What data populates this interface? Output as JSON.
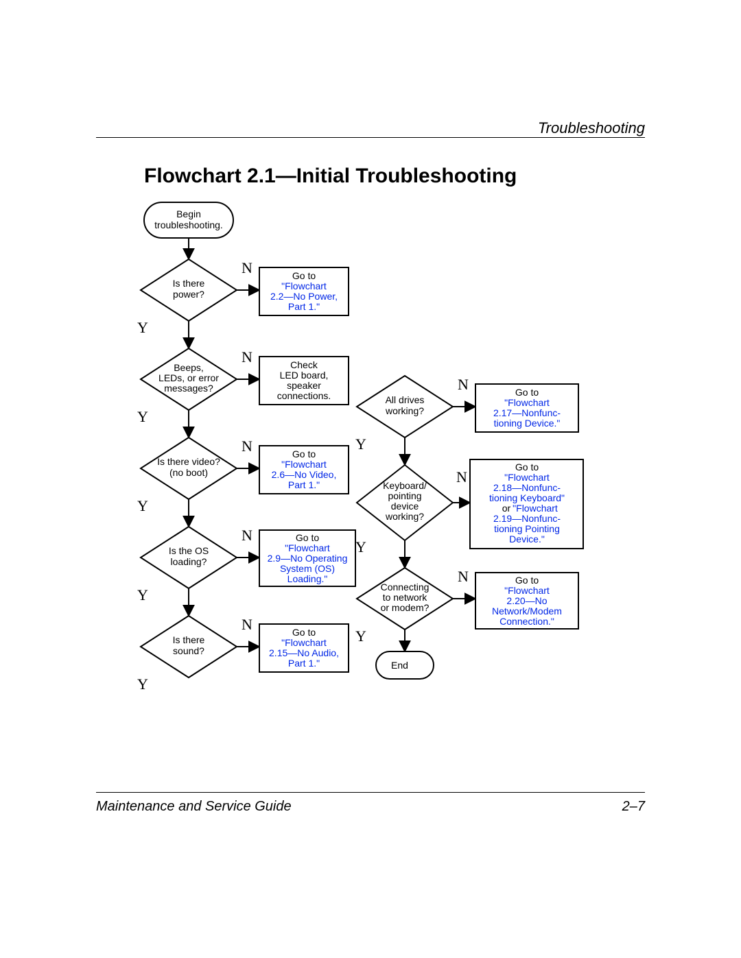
{
  "header": {
    "section": "Troubleshooting"
  },
  "title": "Flowchart 2.1—Initial Troubleshooting",
  "footer": {
    "left": "Maintenance and Service Guide",
    "right": "2–7"
  },
  "labels": {
    "yes": "Y",
    "no": "N"
  },
  "nodes": {
    "start": {
      "type": "terminator",
      "lines": [
        "Begin",
        "troubleshooting."
      ]
    },
    "power": {
      "type": "decision",
      "lines": [
        "Is there",
        "power?"
      ]
    },
    "power_no": {
      "type": "process",
      "prefix": "Go to",
      "link_lines": [
        "\"Flowchart",
        "2.2—No Power,",
        "Part 1.\""
      ]
    },
    "beeps": {
      "type": "decision",
      "lines": [
        "Beeps,",
        "LEDs, or error",
        "messages?"
      ]
    },
    "beeps_no": {
      "type": "process",
      "lines": [
        "Check",
        "LED board,",
        "speaker",
        "connections."
      ]
    },
    "video": {
      "type": "decision",
      "lines": [
        "Is there video?",
        "(no boot)"
      ]
    },
    "video_no": {
      "type": "process",
      "prefix": "Go to",
      "link_lines": [
        "\"Flowchart",
        "2.6—No Video,",
        "Part 1.\""
      ]
    },
    "os": {
      "type": "decision",
      "lines": [
        "Is the OS",
        "loading?"
      ]
    },
    "os_no": {
      "type": "process",
      "prefix": "Go to",
      "link_lines": [
        "\"Flowchart",
        "2.9—No Operating",
        "System (OS)",
        "Loading.\""
      ]
    },
    "sound": {
      "type": "decision",
      "lines": [
        "Is there",
        "sound?"
      ]
    },
    "sound_no": {
      "type": "process",
      "prefix": "Go to",
      "link_lines": [
        "\"Flowchart",
        "2.15—No Audio,",
        "Part 1.\""
      ]
    },
    "drives": {
      "type": "decision",
      "lines": [
        "All drives",
        "working?"
      ]
    },
    "drives_no": {
      "type": "process",
      "prefix": "Go to",
      "link_lines": [
        "\"Flowchart",
        "2.17—Nonfunc-",
        "tioning Device.\""
      ]
    },
    "kbd": {
      "type": "decision",
      "lines": [
        "Keyboard/",
        "pointing",
        "device",
        "working?"
      ]
    },
    "kbd_no": {
      "type": "process",
      "prefix": "Go to",
      "link_lines_a": [
        "\"Flowchart",
        "2.18—Nonfunc-",
        "tioning Keyboard\""
      ],
      "mid": "or",
      "link_lines_b": [
        "\"Flowchart",
        "2.19—Nonfunc-",
        "tioning Pointing",
        "Device.\""
      ]
    },
    "net": {
      "type": "decision",
      "lines": [
        "Connecting",
        "to network",
        "or modem?"
      ]
    },
    "net_no": {
      "type": "process",
      "prefix": "Go to",
      "link_lines": [
        "\"Flowchart",
        "2.20—No",
        "Network/Modem",
        "Connection.\""
      ]
    },
    "end": {
      "type": "terminator",
      "lines": [
        "End"
      ]
    }
  },
  "chart_data": {
    "type": "flowchart",
    "title": "Flowchart 2.1—Initial Troubleshooting",
    "shapes": {
      "terminator": "rounded-rect",
      "decision": "diamond",
      "process": "rect"
    },
    "nodes": [
      {
        "id": "start",
        "type": "terminator",
        "text": "Begin troubleshooting."
      },
      {
        "id": "power",
        "type": "decision",
        "text": "Is there power?"
      },
      {
        "id": "power_no",
        "type": "process",
        "text": "Go to \"Flowchart 2.2—No Power, Part 1.\"",
        "link": true
      },
      {
        "id": "beeps",
        "type": "decision",
        "text": "Beeps, LEDs, or error messages?"
      },
      {
        "id": "beeps_no",
        "type": "process",
        "text": "Check LED board, speaker connections."
      },
      {
        "id": "video",
        "type": "decision",
        "text": "Is there video? (no boot)"
      },
      {
        "id": "video_no",
        "type": "process",
        "text": "Go to \"Flowchart 2.6—No Video, Part 1.\"",
        "link": true
      },
      {
        "id": "os",
        "type": "decision",
        "text": "Is the OS loading?"
      },
      {
        "id": "os_no",
        "type": "process",
        "text": "Go to \"Flowchart 2.9—No Operating System (OS) Loading.\"",
        "link": true
      },
      {
        "id": "sound",
        "type": "decision",
        "text": "Is there sound?"
      },
      {
        "id": "sound_no",
        "type": "process",
        "text": "Go to \"Flowchart 2.15—No Audio, Part 1.\"",
        "link": true
      },
      {
        "id": "drives",
        "type": "decision",
        "text": "All drives working?"
      },
      {
        "id": "drives_no",
        "type": "process",
        "text": "Go to \"Flowchart 2.17—Nonfunctioning Device.\"",
        "link": true
      },
      {
        "id": "kbd",
        "type": "decision",
        "text": "Keyboard/pointing device working?"
      },
      {
        "id": "kbd_no",
        "type": "process",
        "text": "Go to \"Flowchart 2.18—Nonfunctioning Keyboard\" or \"Flowchart 2.19—Nonfunctioning Pointing Device.\"",
        "link": true
      },
      {
        "id": "net",
        "type": "decision",
        "text": "Connecting to network or modem?"
      },
      {
        "id": "net_no",
        "type": "process",
        "text": "Go to \"Flowchart 2.20—No Network/Modem Connection.\"",
        "link": true
      },
      {
        "id": "end",
        "type": "terminator",
        "text": "End"
      }
    ],
    "edges": [
      {
        "from": "start",
        "to": "power"
      },
      {
        "from": "power",
        "to": "power_no",
        "label": "N"
      },
      {
        "from": "power",
        "to": "beeps",
        "label": "Y"
      },
      {
        "from": "beeps",
        "to": "beeps_no",
        "label": "N"
      },
      {
        "from": "beeps",
        "to": "video",
        "label": "Y"
      },
      {
        "from": "video",
        "to": "video_no",
        "label": "N"
      },
      {
        "from": "video",
        "to": "os",
        "label": "Y"
      },
      {
        "from": "os",
        "to": "os_no",
        "label": "N"
      },
      {
        "from": "os",
        "to": "sound",
        "label": "Y"
      },
      {
        "from": "sound",
        "to": "sound_no",
        "label": "N"
      },
      {
        "from": "sound",
        "to": "drives",
        "label": "Y",
        "note": "routes right-column top"
      },
      {
        "from": "drives",
        "to": "drives_no",
        "label": "N"
      },
      {
        "from": "drives",
        "to": "kbd",
        "label": "Y"
      },
      {
        "from": "kbd",
        "to": "kbd_no",
        "label": "N"
      },
      {
        "from": "kbd",
        "to": "net",
        "label": "Y"
      },
      {
        "from": "net",
        "to": "net_no",
        "label": "N"
      },
      {
        "from": "net",
        "to": "end",
        "label": "Y"
      }
    ]
  }
}
